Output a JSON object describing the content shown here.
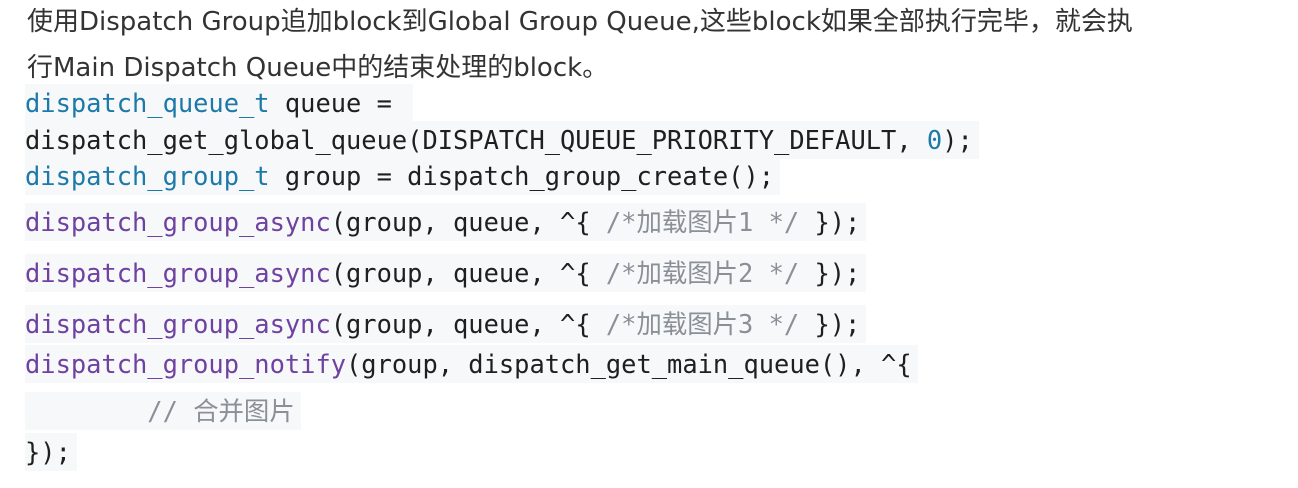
{
  "paragraph": {
    "lines": [
      "使用Dispatch Group追加block到Global Group Queue,这些block如果全部执行完毕，就会执",
      "行Main Dispatch Queue中的结束处理的block。"
    ]
  },
  "code": {
    "lines": [
      [
        {
          "t": "dispatch_queue_t",
          "c": "type"
        },
        {
          "t": " queue = ",
          "c": "plain"
        }
      ],
      [
        {
          "t": "dispatch_get_global_queue(DISPATCH_QUEUE_PRIORITY_DEFAULT, ",
          "c": "plain"
        },
        {
          "t": "0",
          "c": "num"
        },
        {
          "t": ");",
          "c": "plain"
        }
      ],
      [
        {
          "t": "dispatch_group_t",
          "c": "type"
        },
        {
          "t": " group = dispatch_group_create();",
          "c": "plain"
        }
      ],
      [
        {
          "t": "dispatch_group_async",
          "c": "fn"
        },
        {
          "t": "(group, queue, ^{ ",
          "c": "plain"
        },
        {
          "t": "/*加载图片1 */",
          "c": "com"
        },
        {
          "t": " });",
          "c": "plain"
        }
      ],
      [
        {
          "t": "dispatch_group_async",
          "c": "fn"
        },
        {
          "t": "(group, queue, ^{ ",
          "c": "plain"
        },
        {
          "t": "/*加载图片2 */",
          "c": "com"
        },
        {
          "t": " });",
          "c": "plain"
        }
      ],
      [
        {
          "t": "dispatch_group_async",
          "c": "fn"
        },
        {
          "t": "(group, queue, ^{ ",
          "c": "plain"
        },
        {
          "t": "/*加载图片3 */",
          "c": "com"
        },
        {
          "t": " });",
          "c": "plain"
        }
      ],
      [
        {
          "t": "dispatch_group_notify",
          "c": "fn"
        },
        {
          "t": "(group, dispatch_get_main_queue(), ^{",
          "c": "plain"
        }
      ],
      [
        {
          "t": "        ",
          "c": "plain"
        },
        {
          "t": "// 合并图片",
          "c": "com"
        }
      ],
      [
        {
          "t": "});",
          "c": "plain"
        }
      ]
    ]
  }
}
